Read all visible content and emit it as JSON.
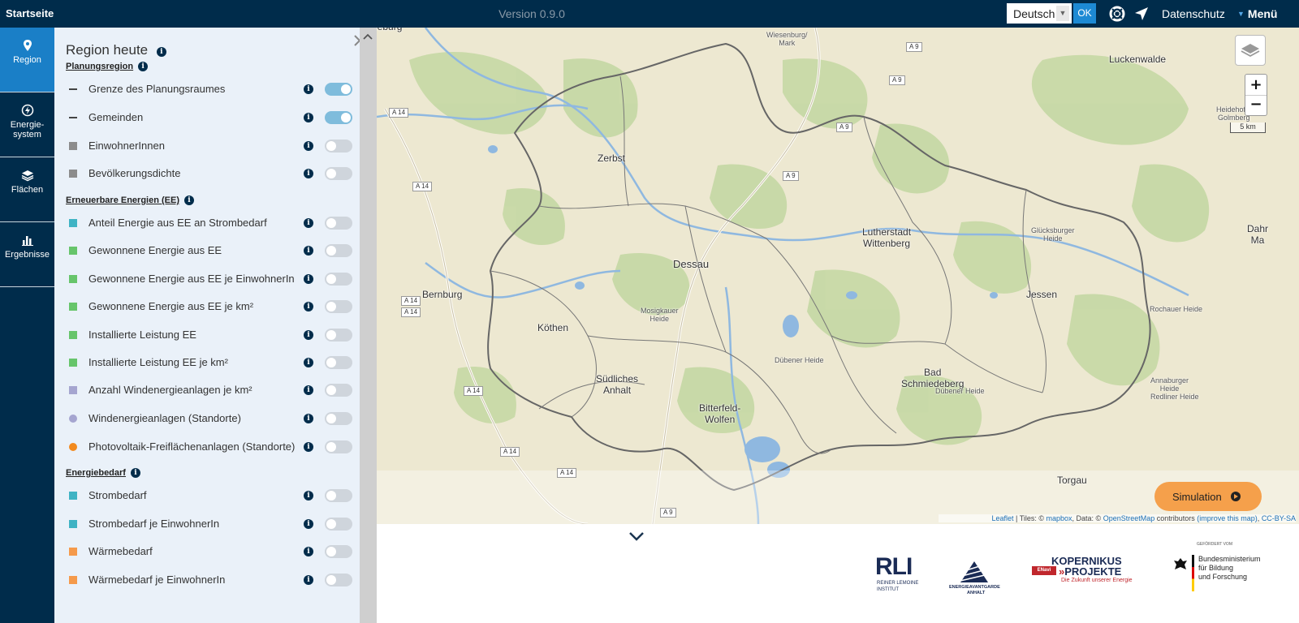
{
  "topbar": {
    "brand": "Startseite",
    "version": "Version 0.9.0",
    "language": "Deutsch",
    "ok_label": "OK",
    "privacy_label": "Datenschutz",
    "menu_label": "Menü"
  },
  "nav": {
    "items": [
      {
        "label": "Region",
        "icon": "map-pin-icon",
        "active": true
      },
      {
        "label": "Energie-\nsystem",
        "icon": "energy-icon",
        "active": false
      },
      {
        "label": "Flächen",
        "icon": "layers-icon",
        "active": false
      },
      {
        "label": "Ergebnisse",
        "icon": "bar-chart-icon",
        "active": false
      }
    ]
  },
  "panel": {
    "title": "Region heute",
    "sections": [
      {
        "title": "Planungsregion",
        "items": [
          {
            "label": "Grenze des Planungsraumes",
            "symbol": "line",
            "color": "#444444",
            "on": true
          },
          {
            "label": "Gemeinden",
            "symbol": "line",
            "color": "#444444",
            "on": true
          },
          {
            "label": "EinwohnerInnen",
            "symbol": "square",
            "color": "#8c8c8c",
            "on": false
          },
          {
            "label": "Bevölkerungsdichte",
            "symbol": "square",
            "color": "#8c8c8c",
            "on": false
          }
        ]
      },
      {
        "title": "Erneuerbare Energien (EE)",
        "items": [
          {
            "label": "Anteil Energie aus EE an Strombedarf",
            "symbol": "square",
            "color": "#3fb3c4",
            "on": false
          },
          {
            "label": "Gewonnene Energie aus EE",
            "symbol": "square",
            "color": "#67c56b",
            "on": false
          },
          {
            "label": "Gewonnene Energie aus EE je EinwohnerIn",
            "symbol": "square",
            "color": "#67c56b",
            "on": false
          },
          {
            "label": "Gewonnene Energie aus EE je km²",
            "symbol": "square",
            "color": "#67c56b",
            "on": false
          },
          {
            "label": "Installierte Leistung EE",
            "symbol": "square",
            "color": "#67c56b",
            "on": false
          },
          {
            "label": "Installierte Leistung EE je km²",
            "symbol": "square",
            "color": "#67c56b",
            "on": false
          },
          {
            "label": "Anzahl Windenergieanlagen je km²",
            "symbol": "square",
            "color": "#a5a5d0",
            "on": false
          },
          {
            "label": "Windenergieanlagen (Standorte)",
            "symbol": "circle",
            "color": "#a5a5d0",
            "on": false
          },
          {
            "label": "Photovoltaik-Freiflächenanlagen (Standorte)",
            "symbol": "circle",
            "color": "#f28a1e",
            "on": false
          }
        ]
      },
      {
        "title": "Energiebedarf",
        "items": [
          {
            "label": "Strombedarf",
            "symbol": "square",
            "color": "#3fb3c4",
            "on": false
          },
          {
            "label": "Strombedarf je EinwohnerIn",
            "symbol": "square",
            "color": "#3fb3c4",
            "on": false
          },
          {
            "label": "Wärmebedarf",
            "symbol": "square",
            "color": "#f59a4b",
            "on": false
          },
          {
            "label": "Wärmebedarf je EinwohnerIn",
            "symbol": "square",
            "color": "#f59a4b",
            "on": false
          }
        ]
      }
    ]
  },
  "map": {
    "places": [
      {
        "name": "Zerbst",
        "cls": ""
      },
      {
        "name": "Dessau",
        "cls": "major"
      },
      {
        "name": "Lutherstadt\nWittenberg",
        "cls": ""
      },
      {
        "name": "Bernburg",
        "cls": ""
      },
      {
        "name": "Köthen",
        "cls": ""
      },
      {
        "name": "Südliches\nAnhalt",
        "cls": ""
      },
      {
        "name": "Bitterfeld-\nWolfen",
        "cls": ""
      },
      {
        "name": "Bad\nSchmiedeberg",
        "cls": ""
      },
      {
        "name": "Jessen",
        "cls": ""
      },
      {
        "name": "Luckenwalde",
        "cls": ""
      },
      {
        "name": "Wiesenburg/\nMark",
        "cls": "small"
      },
      {
        "name": "Glücksburger\nHeide",
        "cls": "small"
      },
      {
        "name": "Mosigkauer\nHeide",
        "cls": "small"
      },
      {
        "name": "Dübener Heide",
        "cls": "small"
      },
      {
        "name": "Dübener Heide",
        "cls": "small"
      },
      {
        "name": "Rochauer Heide",
        "cls": "small"
      },
      {
        "name": "Annaburger\nHeide",
        "cls": "small"
      },
      {
        "name": "Redliner Heide",
        "cls": "small"
      },
      {
        "name": "Heidehof –\nGolmberg",
        "cls": "small"
      },
      {
        "name": "Torgau",
        "cls": ""
      },
      {
        "name": "Dahr\nMa",
        "cls": ""
      },
      {
        "name": "deburg",
        "cls": ""
      }
    ],
    "roads": [
      "A 9",
      "A 9",
      "A 9",
      "A 9",
      "A 14",
      "A 14",
      "A 14",
      "A 14",
      "A 14",
      "A 14",
      "A 14",
      "A 9"
    ],
    "scale": "5 km",
    "zoom_in": "+",
    "zoom_out": "−",
    "attribution": {
      "leaflet": "Leaflet",
      "tiles": " | Tiles: © ",
      "mapbox": "mapbox",
      "data": ", Data: © ",
      "osm": "OpenStreetMap",
      "contrib": " contributors ",
      "improve": "(improve this map)",
      "sep": ", ",
      "license": "CC-BY-SA"
    },
    "simulation_label": "Simulation"
  },
  "footer": {
    "rli": {
      "mark": "RLI",
      "sub1": "REINER LEMOINE",
      "sub2": "INSTITUT"
    },
    "eva": {
      "line1": "ENERGIEAVANTGARDE",
      "line2": "ANHALT"
    },
    "kopernikus": {
      "title": "KOPERNIKUS",
      "sub": "PROJEKTE",
      "badge": "ENavi",
      "tagline": "Die Zukunft unserer Energie"
    },
    "bmbf": {
      "top": "GEFÖRDERT VOM",
      "line1": "Bundesministerium",
      "line2": "für Bildung",
      "line3": "und Forschung"
    }
  },
  "colors": {
    "navy": "#002c4b",
    "accent": "#1a7fc7",
    "panel": "#eaf1f9",
    "toggle_on": "#7fbcdc",
    "sim": "#f5a04b"
  }
}
